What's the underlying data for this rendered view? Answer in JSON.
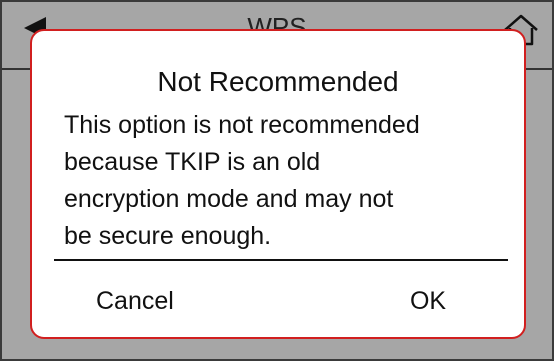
{
  "screen": {
    "title": "WPS",
    "icons": {
      "back": "back-arrow-icon",
      "home": "home-icon"
    }
  },
  "dialog": {
    "title": "Not Recommended",
    "message": "This option is not recommended\nbecause TKIP is an old\nencryption mode and may not\nbe secure enough.",
    "cancel_label": "Cancel",
    "ok_label": "OK"
  },
  "colors": {
    "dialog_border": "#d11f1f",
    "background": "#a6a6a6"
  }
}
